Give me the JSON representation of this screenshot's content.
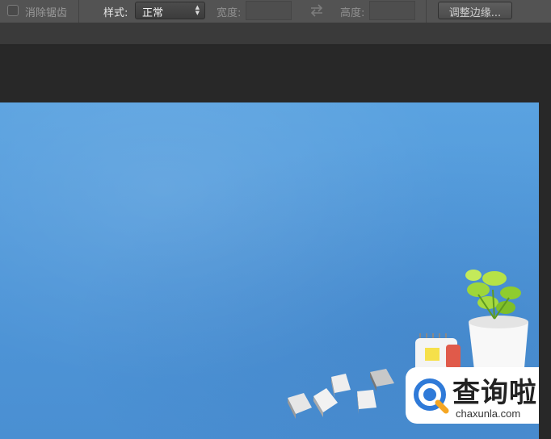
{
  "options_bar": {
    "antialias_label": "消除锯齿",
    "style_label": "样式:",
    "style_value": "正常",
    "width_label": "宽度:",
    "width_value": "",
    "height_label": "高度:",
    "height_value": "",
    "refine_edge_label": "调整边缘..."
  },
  "icons": {
    "select_arrows": "up-down-arrows-icon",
    "swap": "swap-arrows-icon"
  },
  "watermark": {
    "title": "查询啦",
    "url": "chaxunla.com"
  },
  "colors": {
    "canvas_blue": "#5aa2e0",
    "watermark_blue": "#2f7ad8",
    "workspace": "#282828",
    "options_bar": "#535353"
  }
}
